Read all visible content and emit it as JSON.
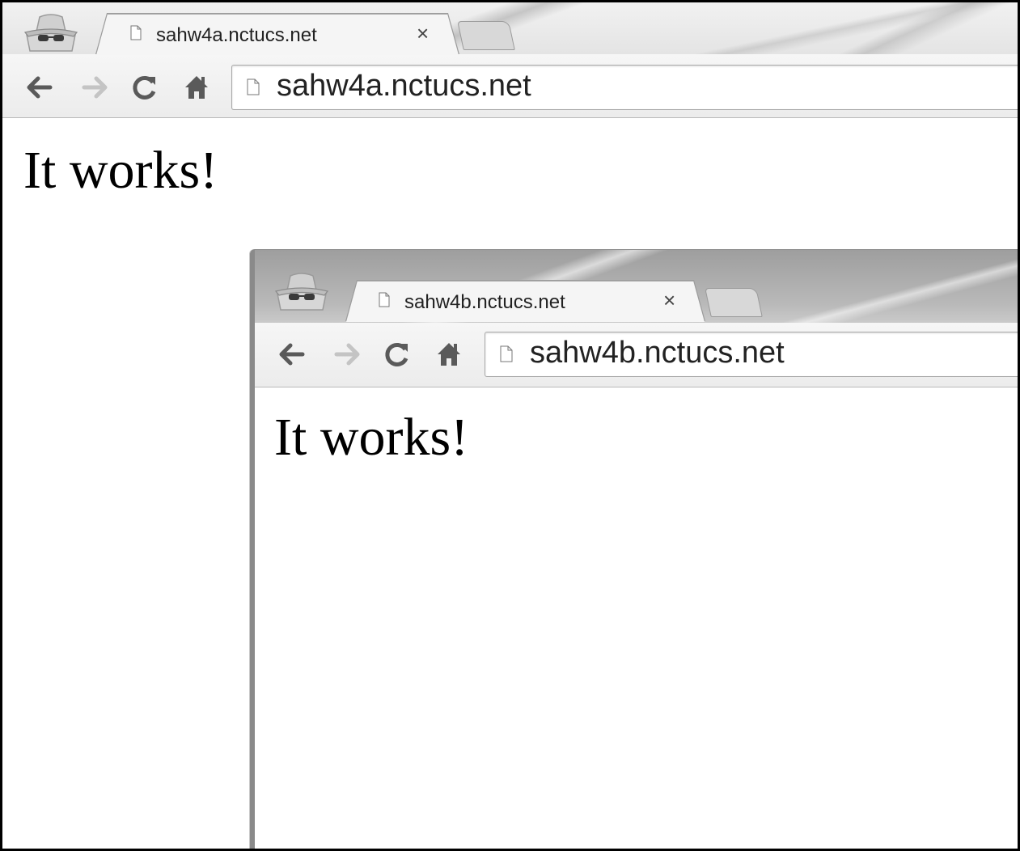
{
  "windows": [
    {
      "tab_title": "sahw4a.nctucs.net",
      "tab_close_glyph": "×",
      "url": "sahw4a.nctucs.net",
      "page_heading": "It works!",
      "icons": [
        "incognito-icon",
        "page-icon",
        "close-icon",
        "back-arrow-icon",
        "forward-arrow-icon",
        "reload-icon",
        "home-icon"
      ]
    },
    {
      "tab_title": "sahw4b.nctucs.net",
      "tab_close_glyph": "×",
      "url": "sahw4b.nctucs.net",
      "page_heading": "It works!",
      "icons": [
        "incognito-icon",
        "page-icon",
        "close-icon",
        "back-arrow-icon",
        "forward-arrow-icon",
        "reload-icon",
        "home-icon"
      ]
    }
  ],
  "colors": {
    "frame_border": "#000000",
    "chrome_gray": "#e8e8e8",
    "icon_dark": "#5a5a5a",
    "icon_disabled": "#c4c4c4"
  }
}
